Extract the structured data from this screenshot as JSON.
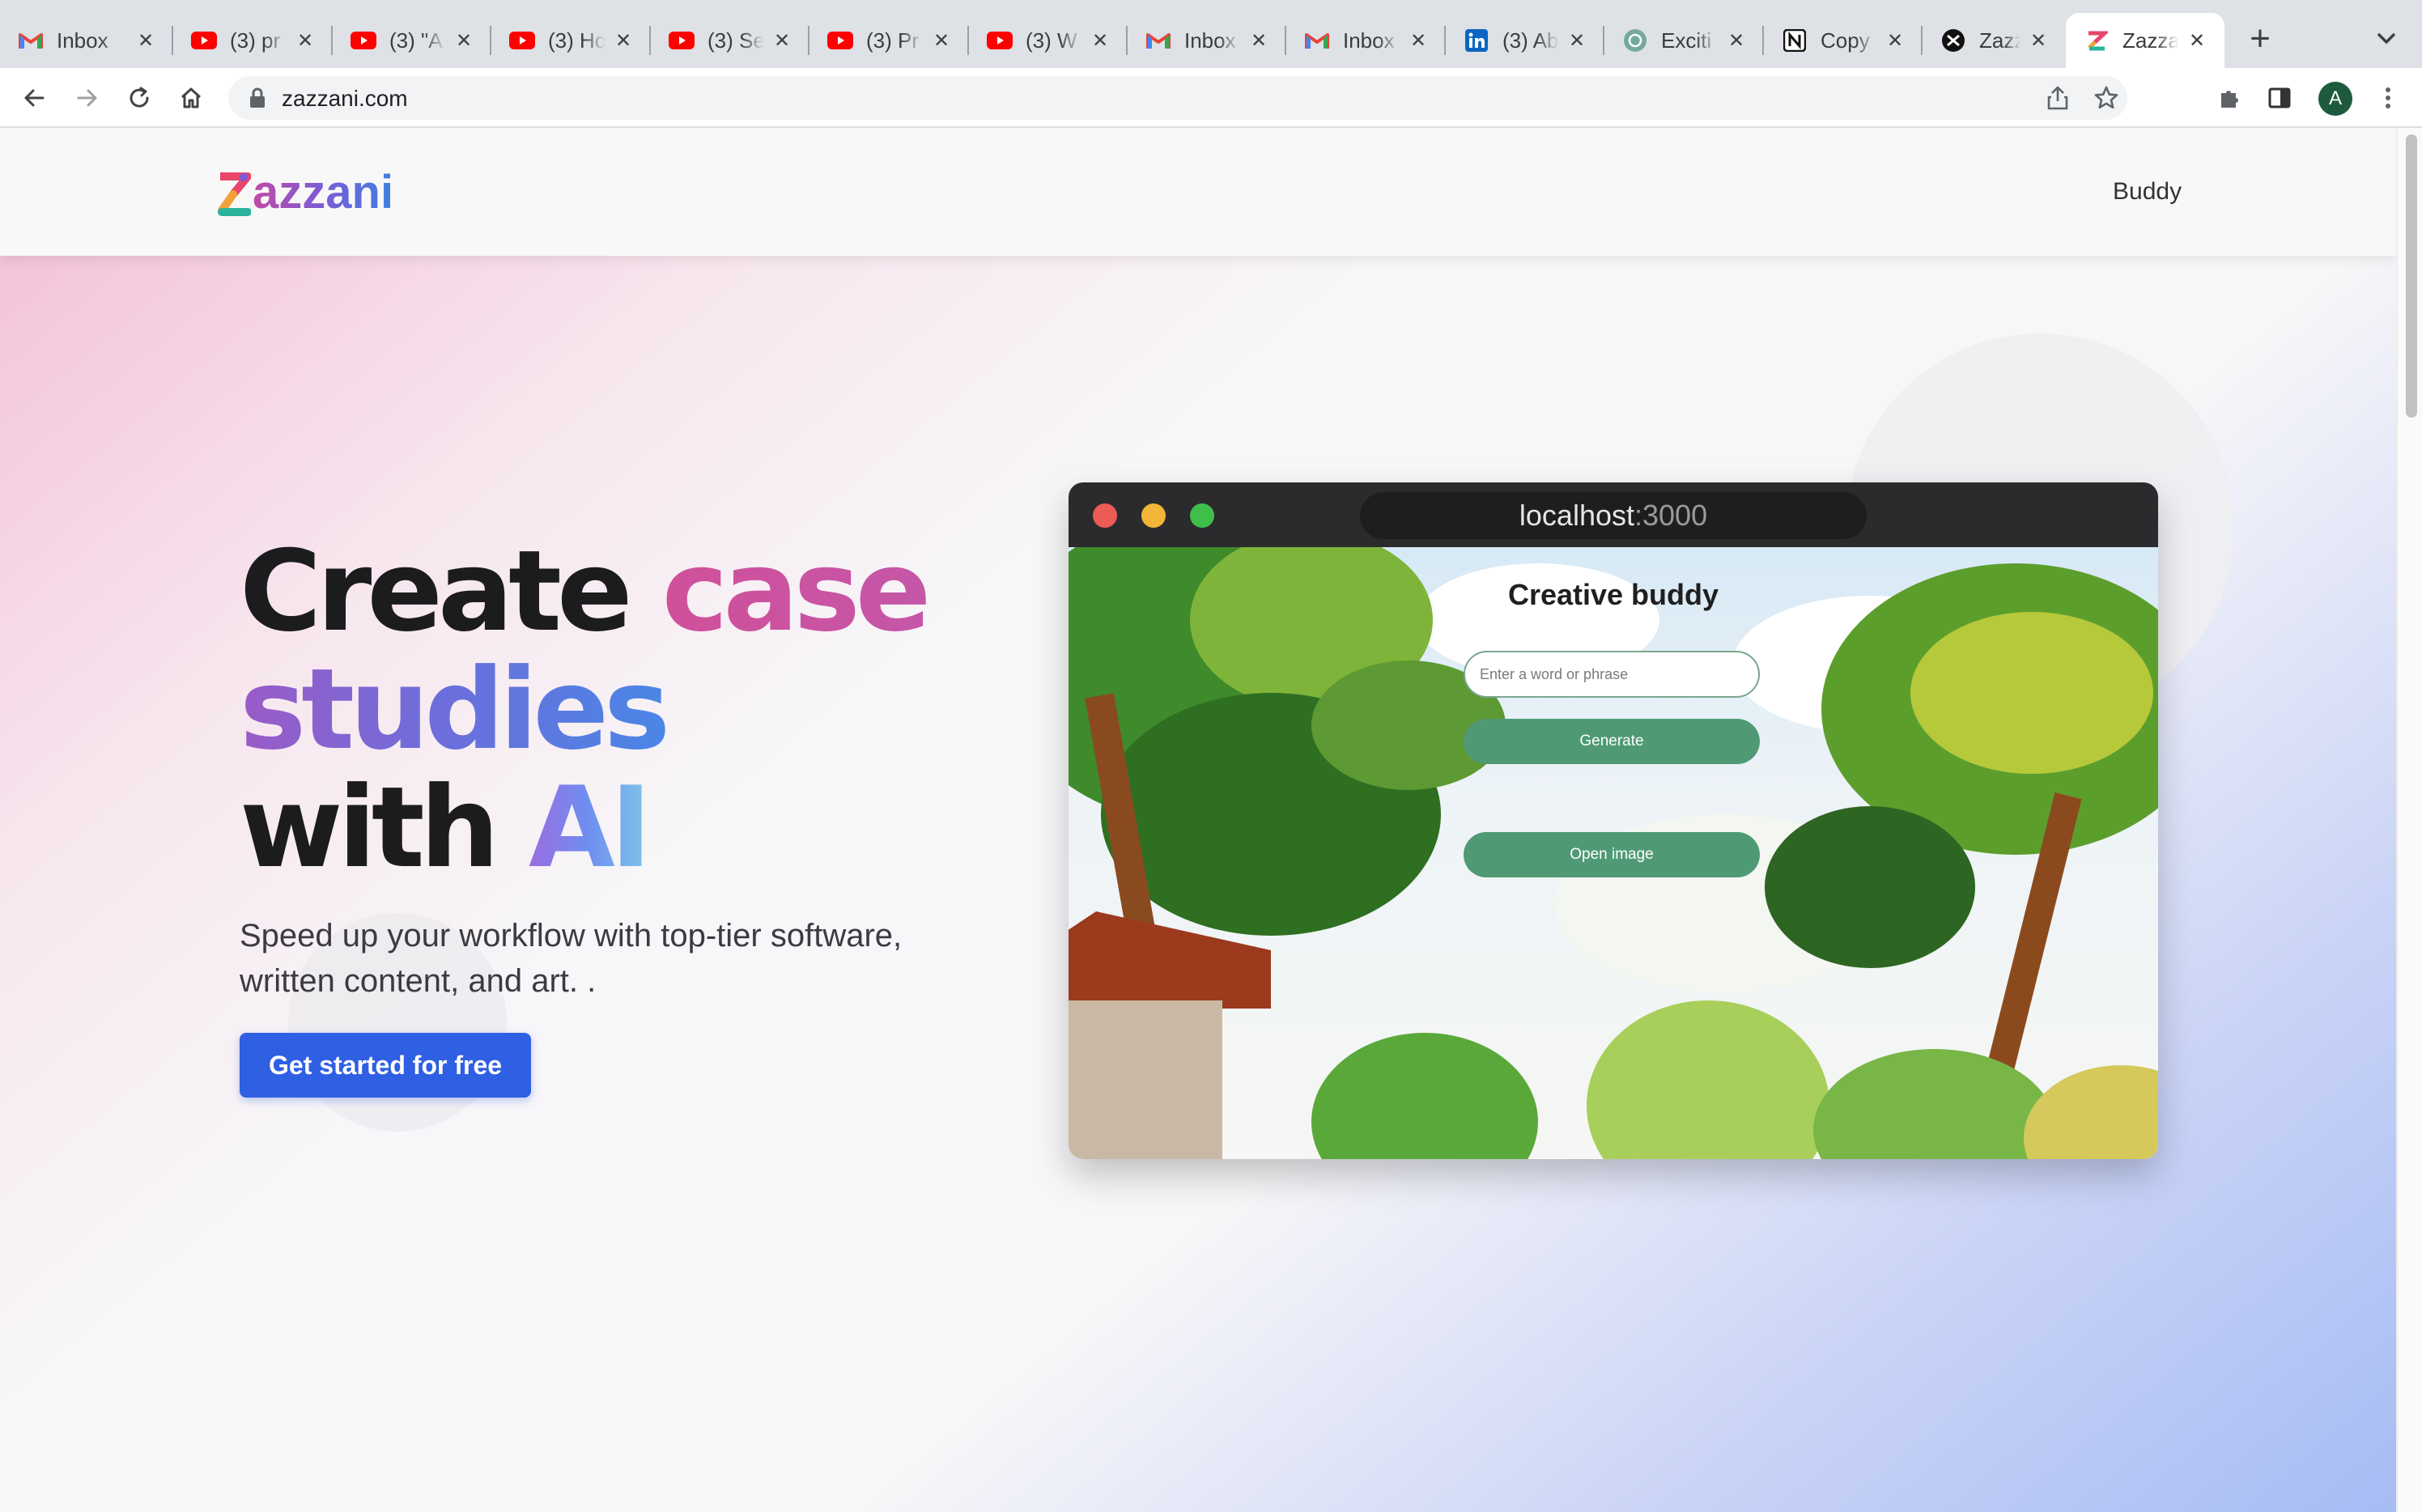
{
  "browser": {
    "tabs": [
      {
        "title": "Inbox",
        "icon": "gmail-icon"
      },
      {
        "title": "(3) pr",
        "icon": "youtube-icon"
      },
      {
        "title": "(3) \"A",
        "icon": "youtube-icon"
      },
      {
        "title": "(3) Ho",
        "icon": "youtube-icon"
      },
      {
        "title": "(3) Se",
        "icon": "youtube-icon"
      },
      {
        "title": "(3) Pr",
        "icon": "youtube-icon"
      },
      {
        "title": "(3) W",
        "icon": "youtube-icon"
      },
      {
        "title": "Inbox",
        "icon": "gmail-icon"
      },
      {
        "title": "Inbox",
        "icon": "gmail-icon"
      },
      {
        "title": "(3) Ab",
        "icon": "linkedin-icon"
      },
      {
        "title": "Exciti",
        "icon": "openai-icon"
      },
      {
        "title": "Copy",
        "icon": "notion-icon"
      },
      {
        "title": "Zazza",
        "icon": "zazzani-dark-icon"
      },
      {
        "title": "Zazza",
        "icon": "zazzani-icon",
        "active": true
      }
    ],
    "new_tab_label": "+",
    "address": "zazzani.com",
    "profile_initial": "A",
    "colors": {
      "youtube": "#ff0000",
      "gmail_red": "#ea4335",
      "linkedin": "#0a66c2",
      "avatar": "#1e5b3e"
    }
  },
  "site": {
    "logo_text": "azzani",
    "nav": {
      "buddy": "Buddy"
    },
    "hero": {
      "title_create": "Create",
      "title_case": "case",
      "title_studies": "studies",
      "title_with": "with",
      "title_ai": "AI",
      "subtitle_line1": "Speed up your workflow with top-tier software,",
      "subtitle_line2": "written content, and art. .",
      "cta": "Get started for free"
    },
    "colors": {
      "cta": "#2f5fe3",
      "accent_pink": "#d0509a",
      "accent_blue": "#4a86e6"
    }
  },
  "mock_window": {
    "url_host": "localhost",
    "url_port": ":3000",
    "app_title": "Creative buddy",
    "input_placeholder": "Enter a word or phrase",
    "generate_label": "Generate",
    "open_image_label": "Open image",
    "colors": {
      "button": "#4f9a75"
    }
  }
}
